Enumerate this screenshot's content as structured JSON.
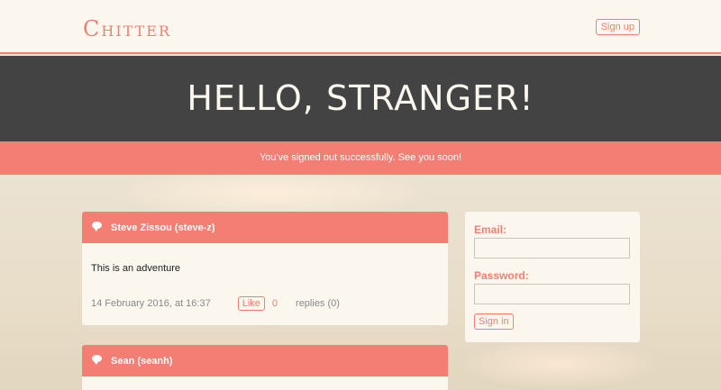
{
  "header": {
    "logo_initial": "C",
    "logo_rest": "HITTER",
    "signup_label": "Sign up"
  },
  "hero": {
    "title": "HELLO, STRANGER!"
  },
  "flash": {
    "message": "You've signed out successfully. See you soon!"
  },
  "peeps": [
    {
      "author": "Steve Zissou (steve-z)",
      "message": "This is an adventure",
      "timestamp": "14 February 2016, at 16:37",
      "like_label": "Like",
      "like_count": "0",
      "replies": "replies (0)"
    },
    {
      "author": "Sean (seanh)"
    }
  ],
  "login": {
    "email_label": "Email:",
    "password_label": "Password:",
    "signin_label": "Sign in"
  },
  "colors": {
    "accent": "#f47e73",
    "dark": "#434343",
    "paper": "#fbf7ef"
  }
}
